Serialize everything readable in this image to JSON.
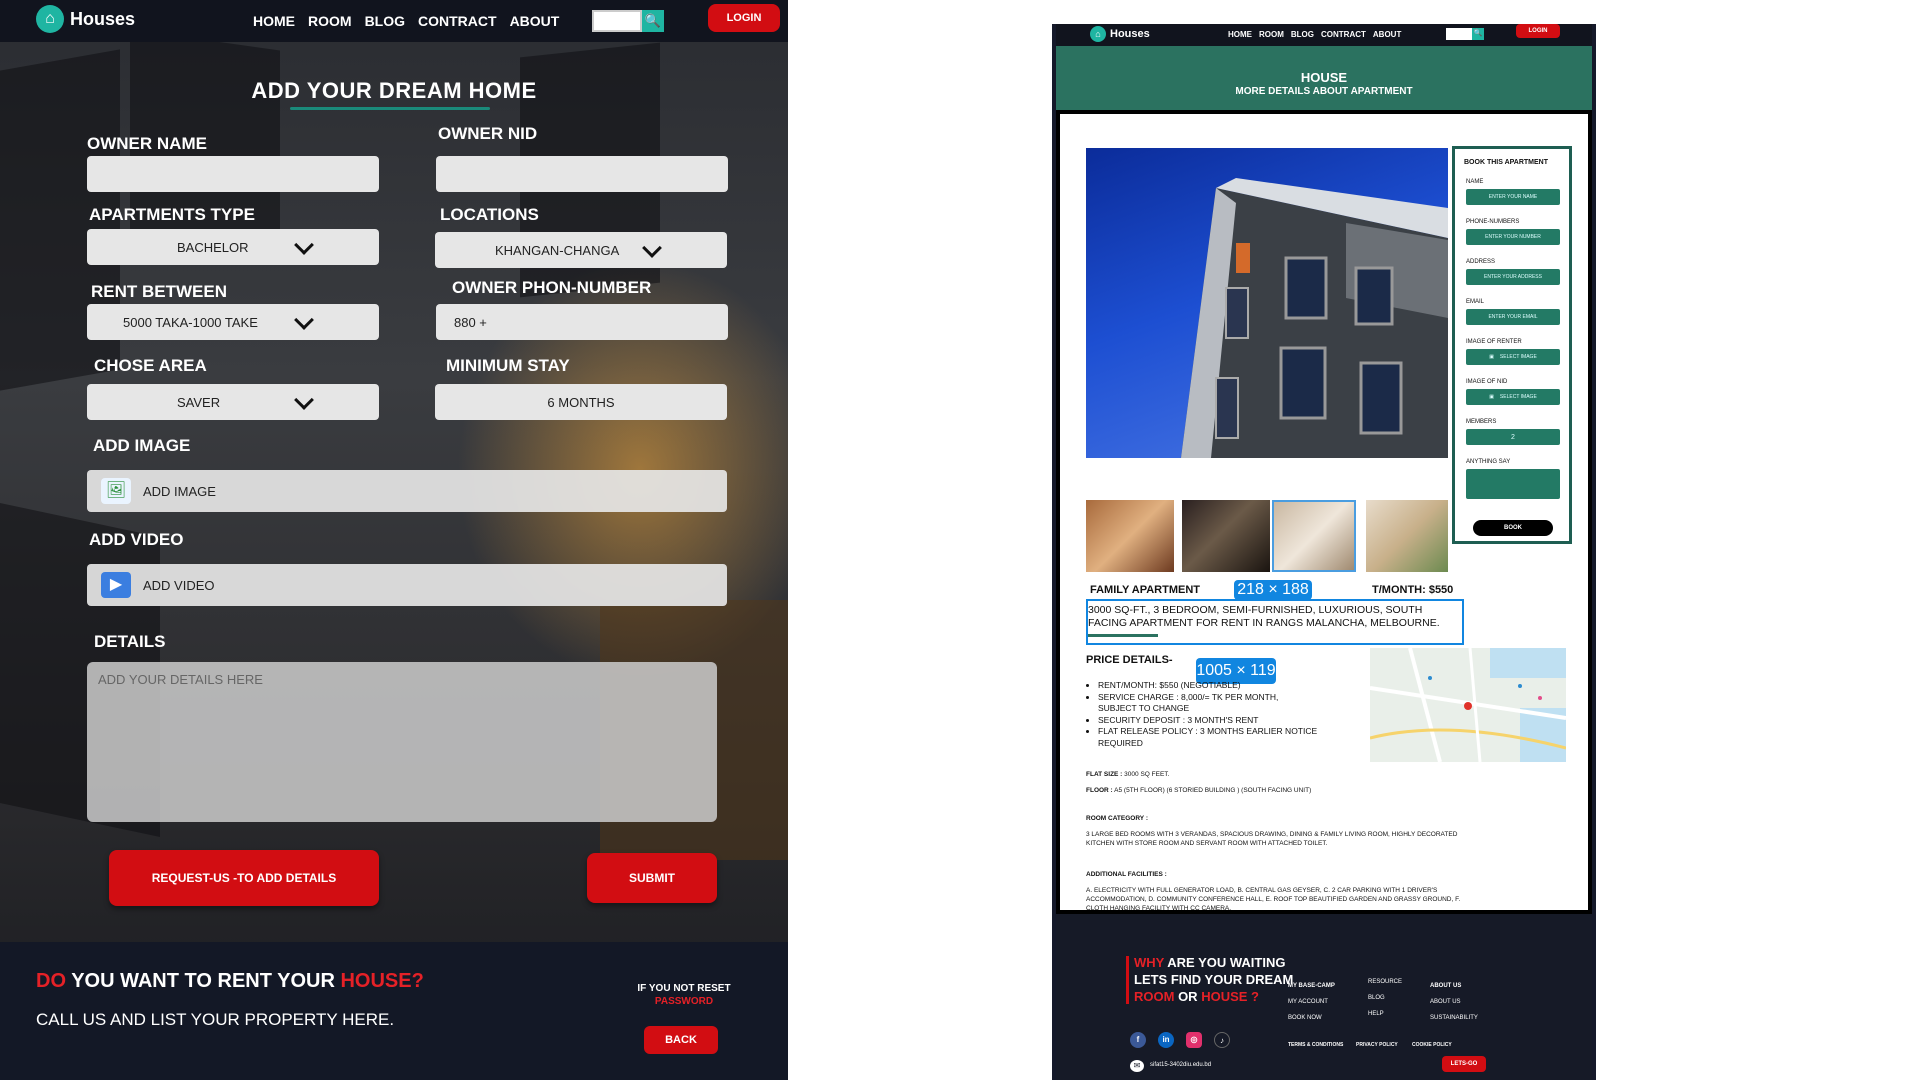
{
  "left": {
    "nav": {
      "brand": "Houses",
      "links": [
        "HOME",
        "ROOM",
        "BLOG",
        "CONTRACT",
        "ABOUT"
      ],
      "login": "LOGIN"
    },
    "form": {
      "title": "ADD YOUR DREAM HOME",
      "owner_name_label": "OWNER NAME",
      "owner_name_value": "",
      "owner_nid_label": "OWNER NID",
      "owner_nid_value": "",
      "apartments_type_label": "APARTMENTS TYPE",
      "apartments_type_value": "BACHELOR",
      "locations_label": "LOCATIONS",
      "locations_value": "KHANGAN-CHANGA",
      "rent_between_label": "RENT BETWEEN",
      "rent_between_value": "5000 TAKA-1000 TAKE",
      "owner_phone_label": "OWNER PHON-NUMBER",
      "owner_phone_value": "880 +",
      "chose_area_label": "CHOSE AREA",
      "chose_area_value": "SAVER",
      "minimum_stay_label": "MINIMUM STAY",
      "minimum_stay_value": "6 MONTHS",
      "add_image_label": "ADD IMAGE",
      "add_image_field": "ADD IMAGE",
      "add_video_label": "ADD VIDEO",
      "add_video_field": "ADD VIDEO",
      "details_label": "DETAILS",
      "details_placeholder": "ADD YOUR DETAILS HERE",
      "request_button": "REQUEST-US -TO ADD DETAILS",
      "submit_button": "SUBMIT"
    },
    "footer": {
      "headline_do": "DO",
      "headline_middle": " YOU WANT TO RENT YOUR ",
      "headline_house": "HOUSE?",
      "subtext": "CALL US AND LIST YOUR PROPERTY HERE.",
      "reset_line1": "IF YOU NOT RESET",
      "reset_line2": "PASSWORD",
      "back_button": "BACK"
    }
  },
  "right": {
    "nav": {
      "brand": "Houses",
      "links": [
        "HOME",
        "ROOM",
        "BLOG",
        "CONTRACT",
        "ABOUT"
      ],
      "login": "LOGIN"
    },
    "hero": {
      "title": "HOUSE",
      "subtitle": "MORE DETAILS ABOUT APARTMENT"
    },
    "booking": {
      "title": "BOOK THIS APARTMENT",
      "name_label": "NAME",
      "name_placeholder": "ENTER YOUR NAME",
      "phone_label": "PHONE-NUMBERS",
      "phone_placeholder": "ENTER YOUR NUMBER",
      "address_label": "ADDRESS",
      "address_placeholder": "ENTER YOUR ADDRESS",
      "email_label": "EMAIL",
      "email_placeholder": "ENTER YOUR EMAIL",
      "renter_image_label": "IMAGE OF RENTER",
      "renter_image_button": "SELECT IMAGE",
      "nid_image_label": "IMAGE OF NID",
      "nid_image_button": "SELECT IMAGE",
      "members_label": "MEMBERS",
      "members_value": "2",
      "anything_label": "ANYTHING SAY",
      "book_button": "BOOK"
    },
    "apartment": {
      "name": "FAMILY APARTMENT",
      "rent": "RENT/MONTH: $550",
      "rent_visible": "T/MONTH: $550",
      "description": "3000 SQ-FT., 3 BEDROOM, SEMI-FURNISHED, LUXURIOUS, SOUTH FACING APARTMENT FOR RENT IN RANGS MALANCHA, MELBOURNE.",
      "badge_1": "218 × 188",
      "badge_2": "1005 × 119",
      "price_title": "PRICE DETAILS-",
      "price_items": [
        "RENT/MONTH: $550 (NEGOTIABLE)",
        "SERVICE CHARGE : 8,000/= TK PER MONTH, SUBJECT TO CHANGE",
        "SECURITY DEPOSIT : 3 MONTH'S RENT",
        "FLAT RELEASE POLICY : 3 MONTHS EARLIER NOTICE REQUIRED"
      ],
      "flat_size_label": "FLAT SIZE :",
      "flat_size_value": "3000 SQ FEET.",
      "floor_label": "FLOOR :",
      "floor_value": "A5 (5TH FLOOR) (6 STORIED BUILDING ) (SOUTH FACING UNIT)",
      "room_category_label": "ROOM CATEGORY :",
      "room_category_value": "3 LARGE BED ROOMS WITH 3 VERANDAS, SPACIOUS DRAWING, DINING & FAMILY LIVING ROOM, HIGHLY DECORATED KITCHEN WITH STORE ROOM AND SERVANT ROOM WITH ATTACHED TOILET.",
      "facilities_label": "ADDITIONAL FACILITIES :",
      "facilities_value": "A. ELECTRICITY WITH FULL GENERATOR LOAD, B. CENTRAL GAS GEYSER, C. 2 CAR PARKING WITH 1 DRIVER'S ACCOMMODATION, D. COMMUNITY CONFERENCE HALL, E. ROOF TOP BEAUTIFIED GARDEN AND GRASSY GROUND, F. CLOTH HANGING FACILITY WITH CC CAMERA."
    },
    "footer": {
      "why": "WHY",
      "line1_rest": " ARE YOU WAITING",
      "line2": "LETS FIND YOUR DREAM",
      "room": "ROOM",
      "or": " OR ",
      "house": "HOUSE ?",
      "col1": [
        "MY BASE-CAMP",
        "MY ACCOUNT",
        "BOOK NOW"
      ],
      "col2": [
        "RESOURCE",
        "BLOG",
        "HELP"
      ],
      "col3": [
        "ABOUT US",
        "ABOUT US",
        "SUSTAINABILITY"
      ],
      "legal": [
        "TERMS & CONDITIONS",
        "PRIVACY POLICY",
        "COOKIE POLICY"
      ],
      "email": "sifat15-3402diu.edu.bd",
      "letsgo": "LETS-GO"
    }
  },
  "colors": {
    "brand_teal": "#1fb5a2",
    "accent_red": "#d20d12",
    "hero_green": "#2b7260",
    "navy": "#11141e"
  }
}
